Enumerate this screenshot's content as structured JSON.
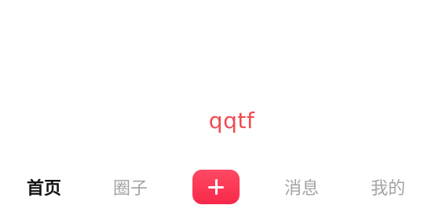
{
  "app": {
    "brand_text": "qqtf"
  },
  "tabbar": {
    "items": [
      {
        "label": "首页",
        "active": true
      },
      {
        "label": "圈子",
        "active": false
      },
      {
        "label": "消息",
        "active": false
      },
      {
        "label": "我的",
        "active": false
      }
    ],
    "publish_icon": "plus-icon"
  },
  "colors": {
    "brand_text": "#f24a4f",
    "publish_button": "#f8284a",
    "tab_active": "#111111",
    "tab_inactive": "#a3a3a3"
  }
}
